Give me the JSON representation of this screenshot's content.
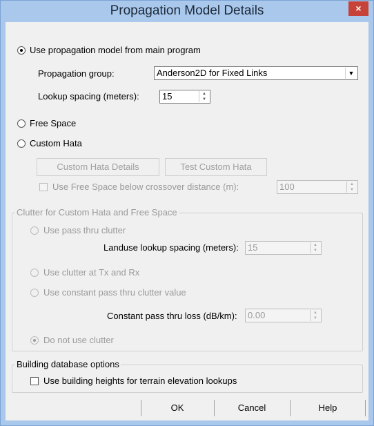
{
  "window": {
    "title": "Propagation Model Details",
    "close_glyph": "×"
  },
  "options": {
    "use_main": "Use propagation model from main program",
    "free_space": "Free Space",
    "custom_hata": "Custom Hata"
  },
  "propagation_group": {
    "label": "Propagation group:",
    "value": "Anderson2D for Fixed Links"
  },
  "lookup_spacing": {
    "label": "Lookup spacing (meters):",
    "value": "15"
  },
  "custom_hata": {
    "details_button": "Custom Hata Details",
    "test_button": "Test Custom Hata",
    "crossover_label": "Use Free Space below crossover distance (m):",
    "crossover_value": "100"
  },
  "clutter": {
    "group_title": "Clutter for Custom Hata and Free Space",
    "pass_thru": "Use pass thru clutter",
    "landuse_label": "Landuse lookup spacing (meters):",
    "landuse_value": "15",
    "at_tx_rx": "Use clutter at Tx and Rx",
    "constant": "Use constant pass thru clutter value",
    "constant_loss_label": "Constant pass thru loss (dB/km):",
    "constant_loss_value": "0.00",
    "do_not_use": "Do not use clutter"
  },
  "building": {
    "group_title": "Building database options",
    "heights_label": "Use building heights for terrain elevation lookups"
  },
  "footer": {
    "ok": "OK",
    "cancel": "Cancel",
    "help": "Help"
  }
}
